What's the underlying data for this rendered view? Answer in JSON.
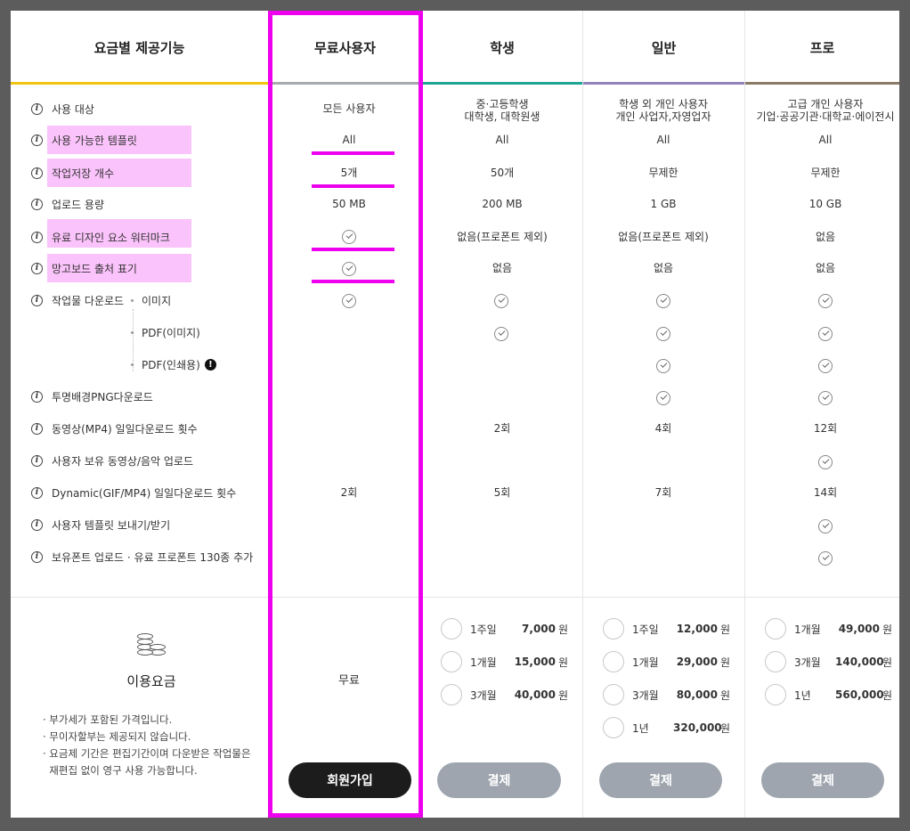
{
  "header": {
    "features": "요금별 제공기능",
    "free": "무료사용자",
    "student": "학생",
    "general": "일반",
    "pro": "프로"
  },
  "colors": {
    "free_bar": "#a7aaad",
    "student_bar": "#1ea493",
    "general_bar": "#9282bd",
    "pro_bar": "#8a7a66",
    "features_bar": "#f1c40f",
    "highlight": "#fbc3fb",
    "annotation": "#ee00ee"
  },
  "features": {
    "target": "사용 대상",
    "templates": "사용 가능한 템플릿",
    "saves": "작업저장 개수",
    "upload": "업로드 용량",
    "watermark": "유료 디자인 요소 워터마크",
    "mangoboard_mark": "망고보드 출처 표기",
    "download": "작업물 다운로드",
    "download_image": "이미지",
    "download_pdf_image": "PDF(이미지)",
    "download_pdf_print": "PDF(인쇄용)",
    "png": "투명배경PNG다운로드",
    "mp4": "동영상(MP4) 일일다운로드 횟수",
    "own_media": "사용자 보유 동영상/음악 업로드",
    "dynamic": "Dynamic(GIF/MP4) 일일다운로드 횟수",
    "send_template": "사용자 템플릿 보내기/받기",
    "fonts": "보유폰트 업로드 · 유료 프로폰트 130종 추가"
  },
  "free": {
    "target": "모든 사용자",
    "templates": "All",
    "saves": "5개",
    "upload": "50 MB",
    "dynamic": "2회",
    "price": "무료",
    "button": "회원가입"
  },
  "student": {
    "target_line1": "중·고등학생",
    "target_line2": "대학생, 대학원생",
    "templates": "All",
    "saves": "50개",
    "upload": "200 MB",
    "watermark": "없음(프로폰트 제외)",
    "mangoboard_mark": "없음",
    "mp4": "2회",
    "dynamic": "5회",
    "options": [
      {
        "period": "1주일",
        "price": "7,000",
        "won": "원"
      },
      {
        "period": "1개월",
        "price": "15,000",
        "won": "원"
      },
      {
        "period": "3개월",
        "price": "40,000",
        "won": "원"
      }
    ],
    "button": "결제"
  },
  "general": {
    "target_line1": "학생 외 개인 사용자",
    "target_line2": "개인 사업자,자영업자",
    "templates": "All",
    "saves": "무제한",
    "upload": "1 GB",
    "watermark": "없음(프로폰트 제외)",
    "mangoboard_mark": "없음",
    "mp4": "4회",
    "dynamic": "7회",
    "options": [
      {
        "period": "1주일",
        "price": "12,000",
        "won": "원"
      },
      {
        "period": "1개월",
        "price": "29,000",
        "won": "원"
      },
      {
        "period": "3개월",
        "price": "80,000",
        "won": "원"
      },
      {
        "period": "1년",
        "price": "320,000",
        "won": "원"
      }
    ],
    "button": "결제"
  },
  "pro": {
    "target_line1": "고급 개인 사용자",
    "target_line2": "기업·공공기관·대학교·에이전시",
    "templates": "All",
    "saves": "무제한",
    "upload": "10 GB",
    "watermark": "없음",
    "mangoboard_mark": "없음",
    "mp4": "12회",
    "dynamic": "14회",
    "options": [
      {
        "period": "1개월",
        "price": "49,000",
        "won": "원"
      },
      {
        "period": "3개월",
        "price": "140,000",
        "won": "원"
      },
      {
        "period": "1년",
        "price": "560,000",
        "won": "원"
      }
    ],
    "button": "결제"
  },
  "pricing": {
    "title": "이용요금",
    "notes": [
      "· 부가세가 포함된 가격입니다.",
      "· 무이자할부는 제공되지 않습니다.",
      "· 요금제 기간은 편집기간이며 다운받은 작업물은",
      "  재편집 없이 영구 사용 가능합니다."
    ]
  },
  "icons": {
    "info": "info-icon",
    "check": "check-circle-icon",
    "warning": "exclamation-icon",
    "coins": "coins-icon"
  }
}
